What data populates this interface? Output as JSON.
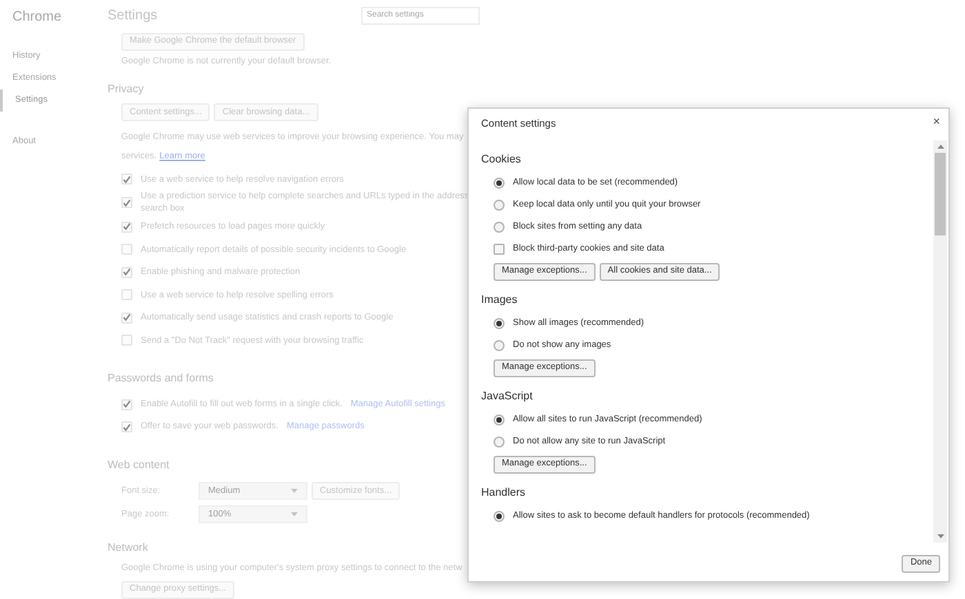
{
  "sidebar": {
    "title": "Chrome",
    "items": [
      {
        "label": "History",
        "selected": false
      },
      {
        "label": "Extensions",
        "selected": false
      },
      {
        "label": "Settings",
        "selected": true
      },
      {
        "label": "About",
        "selected": false
      }
    ]
  },
  "page_title": "Settings",
  "search": {
    "placeholder": "Search settings"
  },
  "default_browser": {
    "button": "Make Google Chrome the default browser",
    "note": "Google Chrome is not currently your default browser."
  },
  "privacy": {
    "heading": "Privacy",
    "buttons": [
      "Content settings...",
      "Clear browsing data..."
    ],
    "description": "Google Chrome may use web services to improve your browsing experience. You may",
    "description_2": "services.",
    "link": "Learn more",
    "options": [
      {
        "lines": [
          "Use a web service to help resolve navigation errors"
        ],
        "checked": true
      },
      {
        "lines": [
          "Use a prediction service to help complete searches and URLs typed in the address",
          "search box"
        ],
        "checked": true
      },
      {
        "lines": [
          "Prefetch resources to load pages more quickly"
        ],
        "checked": true
      },
      {
        "lines": [
          "Automatically report details of possible security incidents to Google"
        ],
        "checked": false
      },
      {
        "lines": [
          "Enable phishing and malware protection"
        ],
        "checked": true
      },
      {
        "lines": [
          "Use a web service to help resolve spelling errors"
        ],
        "checked": false
      },
      {
        "lines": [
          "Automatically send usage statistics and crash reports to Google"
        ],
        "checked": true
      },
      {
        "lines": [
          "Send a \"Do Not Track\" request with your browsing traffic"
        ],
        "checked": false
      }
    ]
  },
  "passwords": {
    "heading": "Passwords and forms",
    "options": [
      {
        "label": "Enable Autofill to fill out web forms in a single click.",
        "link": "Manage Autofill settings",
        "checked": true
      },
      {
        "label": "Offer to save your web passwords.",
        "link": "Manage passwords",
        "checked": true
      }
    ]
  },
  "web_content": {
    "heading": "Web content",
    "font_size": {
      "label": "Font size:",
      "value": "Medium"
    },
    "customize_button": "Customize fonts...",
    "page_zoom": {
      "label": "Page zoom:",
      "value": "100%"
    }
  },
  "network": {
    "heading": "Network",
    "text": "Google Chrome is using your computer's system proxy settings to connect to the netw",
    "button": "Change proxy settings..."
  },
  "dialog": {
    "title": "Content settings",
    "close": "×",
    "sections": [
      {
        "heading": "Cookies",
        "options": [
          {
            "kind": "radio",
            "label": "Allow local data to be set (recommended)",
            "selected": true
          },
          {
            "kind": "radio",
            "label": "Keep local data only until you quit your browser",
            "selected": false
          },
          {
            "kind": "radio",
            "label": "Block sites from setting any data",
            "selected": false
          },
          {
            "kind": "checkbox",
            "label": "Block third-party cookies and site data",
            "checked": false
          }
        ],
        "buttons": [
          "Manage exceptions...",
          "All cookies and site data..."
        ]
      },
      {
        "heading": "Images",
        "options": [
          {
            "kind": "radio",
            "label": "Show all images (recommended)",
            "selected": true
          },
          {
            "kind": "radio",
            "label": "Do not show any images",
            "selected": false
          }
        ],
        "buttons": [
          "Manage exceptions..."
        ]
      },
      {
        "heading": "JavaScript",
        "options": [
          {
            "kind": "radio",
            "label": "Allow all sites to run JavaScript (recommended)",
            "selected": true
          },
          {
            "kind": "radio",
            "label": "Do not allow any site to run JavaScript",
            "selected": false
          }
        ],
        "buttons": [
          "Manage exceptions..."
        ]
      },
      {
        "heading": "Handlers",
        "options": [
          {
            "kind": "radio",
            "label": "Allow sites to ask to become default handlers for protocols (recommended)",
            "selected": true
          }
        ]
      }
    ],
    "done": "Done"
  }
}
